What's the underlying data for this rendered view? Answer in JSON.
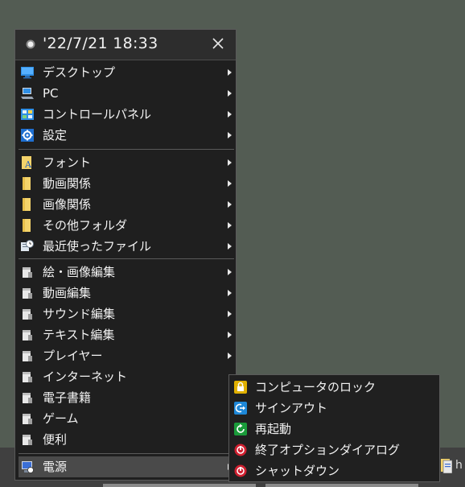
{
  "menu": {
    "header": {
      "datetime": "'22/7/21 18:33"
    },
    "groups": [
      [
        {
          "label": "デスクトップ",
          "icon": "desktop-icon",
          "has_submenu": true
        },
        {
          "label": "PC",
          "icon": "pc-icon",
          "has_submenu": true
        },
        {
          "label": "コントロールパネル",
          "icon": "control-panel-icon",
          "has_submenu": true
        },
        {
          "label": "設定",
          "icon": "settings-gear-icon",
          "has_submenu": true
        }
      ],
      [
        {
          "label": "フォント",
          "icon": "font-folder-icon",
          "has_submenu": true
        },
        {
          "label": "動画関係",
          "icon": "folder-icon",
          "has_submenu": true
        },
        {
          "label": "画像関係",
          "icon": "folder-icon",
          "has_submenu": true
        },
        {
          "label": "その他フォルダ",
          "icon": "folder-icon",
          "has_submenu": true
        },
        {
          "label": "最近使ったファイル",
          "icon": "recent-files-icon",
          "has_submenu": true
        }
      ],
      [
        {
          "label": "絵・画像編集",
          "icon": "app-group-icon",
          "has_submenu": true
        },
        {
          "label": "動画編集",
          "icon": "app-group-icon",
          "has_submenu": true
        },
        {
          "label": "サウンド編集",
          "icon": "app-group-icon",
          "has_submenu": true
        },
        {
          "label": "テキスト編集",
          "icon": "app-group-icon",
          "has_submenu": true
        },
        {
          "label": "プレイヤー",
          "icon": "app-group-icon",
          "has_submenu": true
        },
        {
          "label": "インターネット",
          "icon": "app-group-icon",
          "has_submenu": false
        },
        {
          "label": "電子書籍",
          "icon": "app-group-icon",
          "has_submenu": false
        },
        {
          "label": "ゲーム",
          "icon": "app-group-icon",
          "has_submenu": false
        },
        {
          "label": "便利",
          "icon": "app-group-icon",
          "has_submenu": false
        }
      ],
      [
        {
          "label": "電源",
          "icon": "power-computer-icon",
          "has_submenu": true,
          "active": true
        }
      ]
    ]
  },
  "power_submenu": [
    {
      "label": "コンピュータのロック",
      "icon": "lock-icon",
      "color": "#e0b000"
    },
    {
      "label": "サインアウト",
      "icon": "sign-out-icon",
      "color": "#1e88d8"
    },
    {
      "label": "再起動",
      "icon": "restart-icon",
      "color": "#1a9b3a"
    },
    {
      "label": "終了オプションダイアログ",
      "icon": "shutdown-dialog-icon",
      "color": "#d02030"
    },
    {
      "label": "シャットダウン",
      "icon": "shutdown-icon",
      "color": "#d02030"
    }
  ],
  "taskbar": {
    "partial_text": "h"
  }
}
